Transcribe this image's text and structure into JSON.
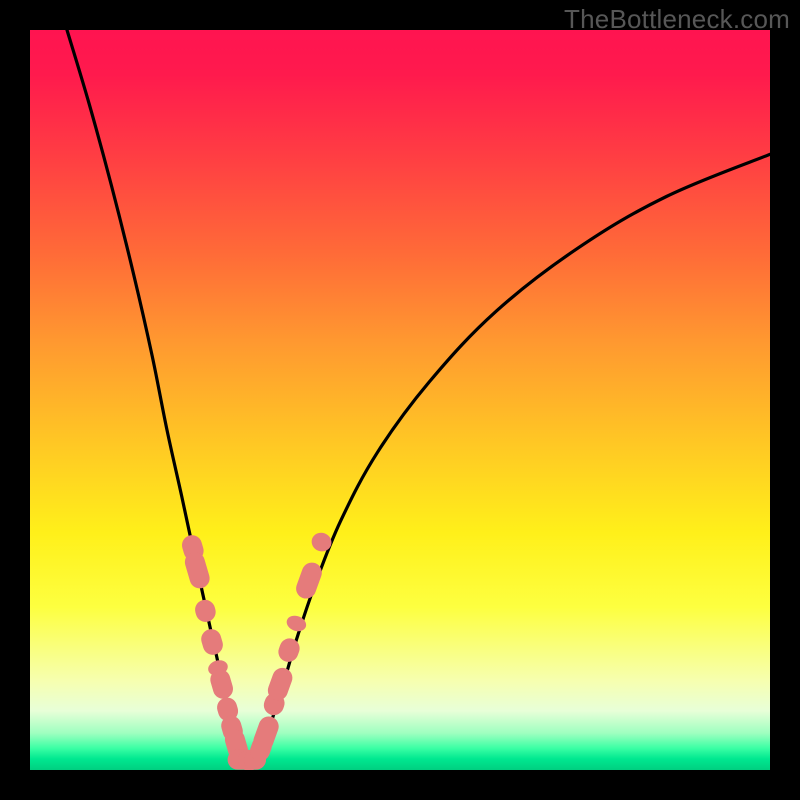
{
  "watermark": "TheBottleneck.com",
  "colors": {
    "background": "#000000",
    "curve": "#000000",
    "marker_fill": "#e57b7b",
    "marker_stroke": "#c26666",
    "gradient_top": "#ff1450",
    "gradient_mid": "#ffe018",
    "gradient_bottom": "#00cf80"
  },
  "chart_data": {
    "type": "line",
    "title": "",
    "xlabel": "",
    "ylabel": "",
    "xlim": [
      0,
      100
    ],
    "ylim": [
      0,
      100
    ],
    "grid": false,
    "legend": false,
    "notes": "Two smooth branches meeting near the bottom forming a V shape. Background is a vertical rainbow gradient (red top, green bottom) on a black frame. No tick labels or axis text visible. Pink capsule-shaped markers cluster around the valley.",
    "series": [
      {
        "name": "left-branch",
        "x": [
          5,
          8,
          11,
          14,
          16.5,
          18.5,
          20.5,
          22,
          23.3,
          24.4,
          25.3,
          26,
          26.6,
          27.1,
          27.5,
          27.9,
          28.2,
          28.5
        ],
        "y": [
          100,
          90,
          79,
          67,
          56,
          46,
          37,
          30,
          24,
          19,
          15,
          11.5,
          8.5,
          6.2,
          4.4,
          3.0,
          2.1,
          1.5
        ]
      },
      {
        "name": "right-branch",
        "x": [
          30.5,
          31,
          31.8,
          32.8,
          34.2,
          36,
          38.5,
          42,
          47,
          54,
          63,
          74,
          86,
          100
        ],
        "y": [
          1.5,
          2.3,
          4.0,
          7.1,
          11.5,
          17.6,
          25,
          33.7,
          43,
          52.5,
          62,
          70.5,
          77.5,
          83.2
        ]
      }
    ],
    "valley_floor": {
      "x": [
        28.5,
        30.5
      ],
      "y": 1.3
    },
    "markers": [
      {
        "branch": "left",
        "x": 22.0,
        "y": 30.0,
        "len": 3.5
      },
      {
        "branch": "left",
        "x": 22.6,
        "y": 27.0,
        "len": 5.0
      },
      {
        "branch": "left",
        "x": 23.7,
        "y": 21.5,
        "len": 3.0
      },
      {
        "branch": "left",
        "x": 24.6,
        "y": 17.3,
        "len": 3.5
      },
      {
        "branch": "left",
        "x": 25.4,
        "y": 13.8,
        "len": 2.0
      },
      {
        "branch": "left",
        "x": 25.9,
        "y": 11.6,
        "len": 4.0
      },
      {
        "branch": "left",
        "x": 26.7,
        "y": 8.2,
        "len": 3.2
      },
      {
        "branch": "left",
        "x": 27.3,
        "y": 5.6,
        "len": 3.5
      },
      {
        "branch": "left",
        "x": 27.9,
        "y": 3.4,
        "len": 4.2
      },
      {
        "branch": "floor",
        "x": 28.7,
        "y": 1.4,
        "len": 4.0
      },
      {
        "branch": "floor",
        "x": 29.6,
        "y": 1.3,
        "len": 3.0
      },
      {
        "branch": "floor",
        "x": 30.4,
        "y": 1.4,
        "len": 3.0
      },
      {
        "branch": "right",
        "x": 31.2,
        "y": 2.9,
        "len": 3.4
      },
      {
        "branch": "right",
        "x": 31.9,
        "y": 4.9,
        "len": 4.8
      },
      {
        "branch": "right",
        "x": 33.0,
        "y": 8.9,
        "len": 3.0
      },
      {
        "branch": "right",
        "x": 33.8,
        "y": 11.6,
        "len": 4.5
      },
      {
        "branch": "right",
        "x": 35.0,
        "y": 16.2,
        "len": 3.2
      },
      {
        "branch": "right",
        "x": 36.0,
        "y": 19.8,
        "len": 2.0
      },
      {
        "branch": "right",
        "x": 37.7,
        "y": 25.6,
        "len": 5.0
      },
      {
        "branch": "right",
        "x": 39.4,
        "y": 30.8,
        "len": 2.5
      }
    ]
  }
}
